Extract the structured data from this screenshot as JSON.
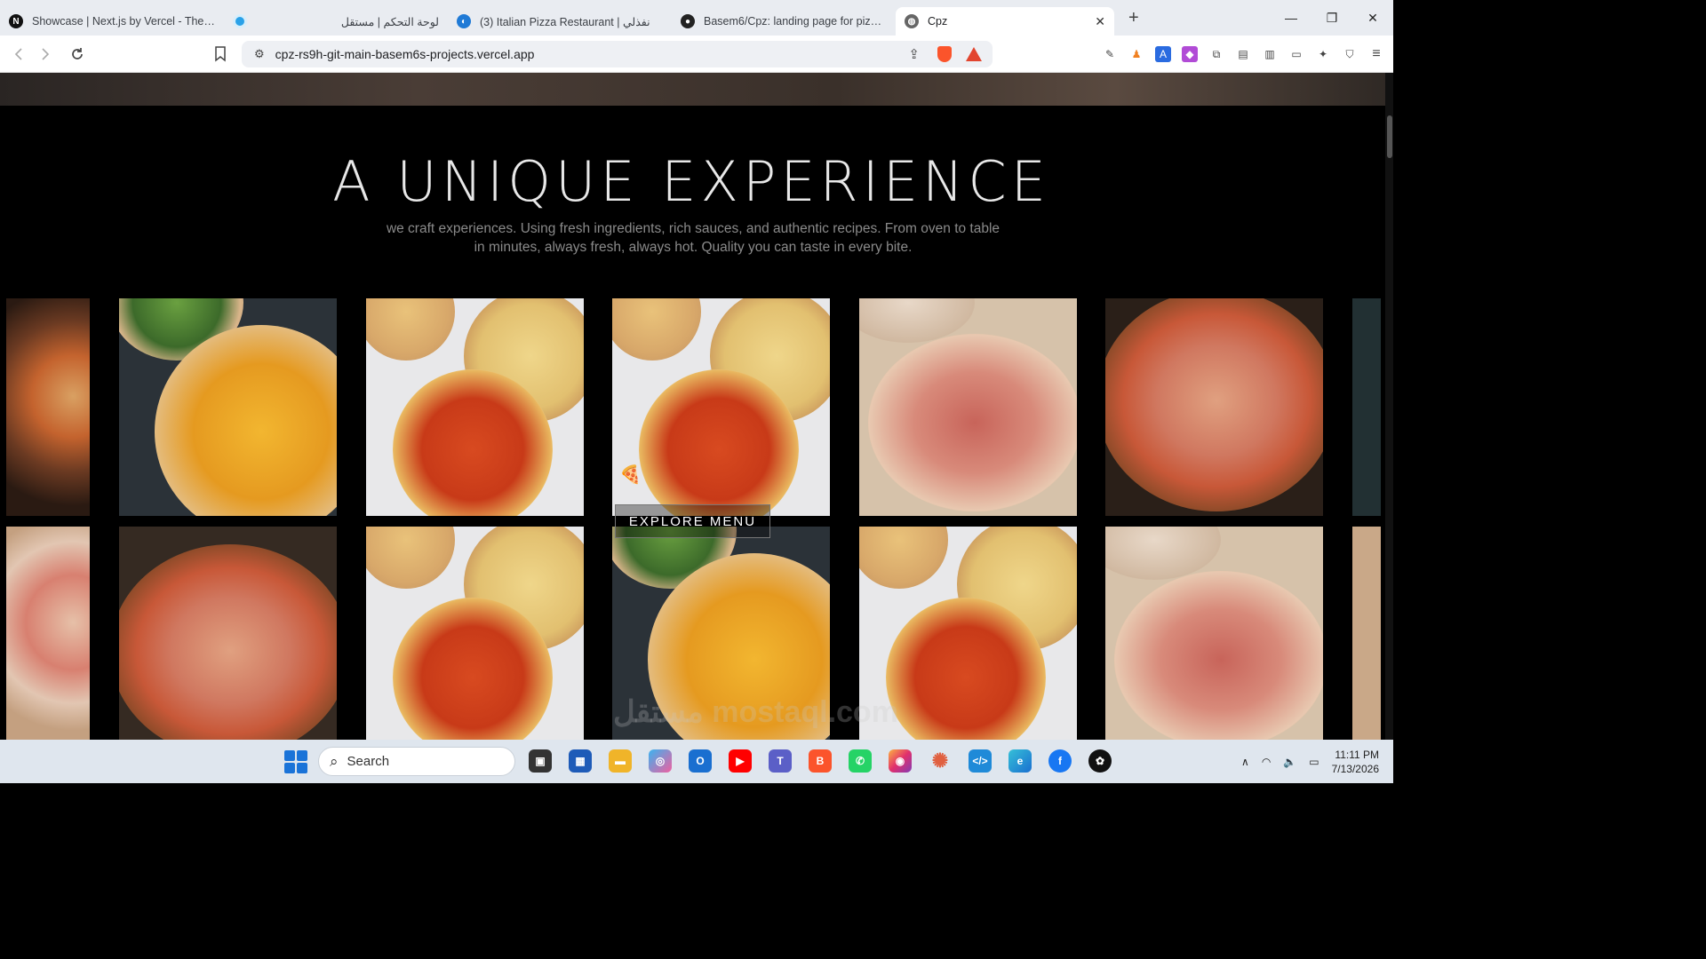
{
  "browser": {
    "tabs": [
      {
        "title": "Showcase | Next.js by Vercel - The React Framework",
        "favicon": "nextjs-icon"
      },
      {
        "title": "لوحة التحكم | مستقل",
        "favicon": "mostaql-icon"
      },
      {
        "title": "(3) Italian Pizza Restaurant | نفذلي",
        "favicon": "nafezly-icon"
      },
      {
        "title": "Basem6/Cpz: landing page for pizza restaurant",
        "favicon": "github-icon"
      },
      {
        "title": "Cpz",
        "favicon": "globe-icon"
      }
    ],
    "new_tab": "+",
    "url": "cpz-rs9h-git-main-basem6s-projects.vercel.app"
  },
  "page": {
    "heading": "A UNIQUE EXPERIENCE",
    "description": "we craft experiences. Using fresh ingredients, rich sauces, and authentic recipes. From oven to table in minutes, always fresh, always hot. Quality you can taste in every bite.",
    "cta": "EXPLORE MENU",
    "watermark": "مستقل mostaql.com"
  },
  "taskbar": {
    "search_placeholder": "Search",
    "time": "11:11 PM",
    "date": "7/13/2026"
  },
  "colors": {
    "brand_brave": "#fb542b",
    "page_bg": "#000000",
    "accent_blue": "#1a73d8"
  }
}
